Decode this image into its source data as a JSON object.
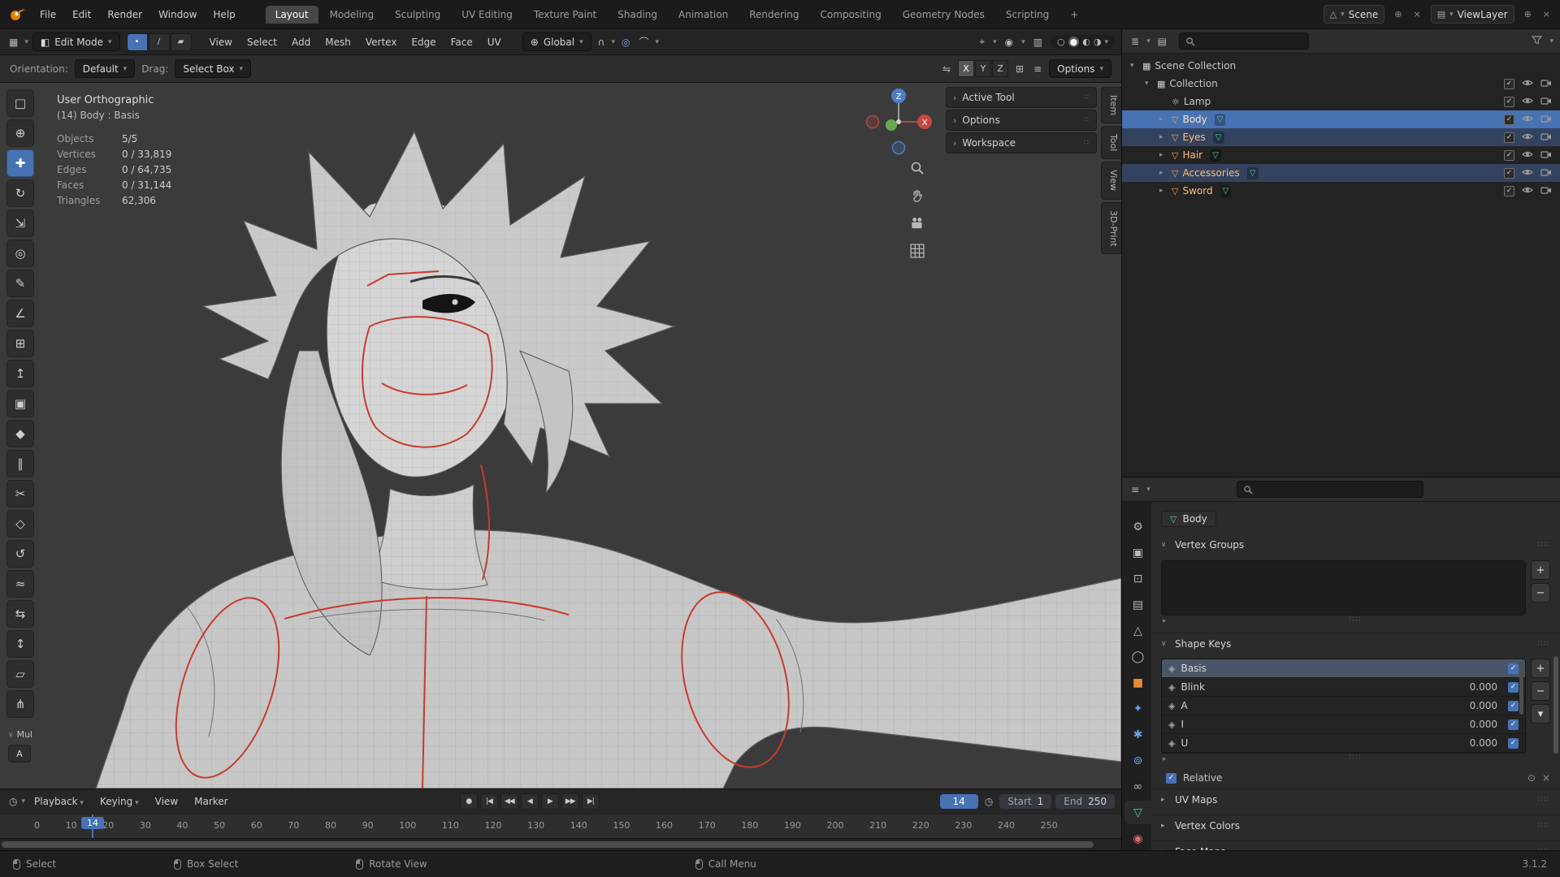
{
  "colors": {
    "accent": "#4772b3",
    "object_orange": "#ffa04d",
    "selected_text": "#ffbd7a",
    "mesh_green": "#3fd6a4",
    "seam_red": "#c93a2f"
  },
  "icons": {
    "tri_down": "▾",
    "tri_right": "▸",
    "chevron_down": "∨",
    "chevron_right": "›",
    "plus": "+",
    "minus": "−",
    "grip": "∷∷",
    "dots_grip": "∷",
    "check": "✓",
    "close": "×",
    "new": "⊕",
    "mesh": "▽",
    "collection": "▦",
    "shapekey": "◈",
    "magnet": "∩",
    "proportional": "◎",
    "falloff": "⌒",
    "pin": "⊙",
    "editor_viewport": "▦",
    "editor_outliner": "≣",
    "editor_properties": "≡",
    "editor_timeline": "◷",
    "objects_filter": "▤",
    "mirror": "⇋",
    "grid": "⊞",
    "sliders": "≡",
    "xray": "▥",
    "overlays": "◉",
    "gizmos": "⌖",
    "scene": "△",
    "view_layer": "▤",
    "vertex_mode": "•",
    "edge_mode": "∕",
    "face_mode": "▰",
    "edit_mode": "◧",
    "global_orientation": "⊕",
    "shading_wireframe": "○",
    "shading_solid": "●",
    "shading_material": "◐",
    "shading_rendered": "◑"
  },
  "topbar": {
    "menus": [
      "File",
      "Edit",
      "Render",
      "Window",
      "Help"
    ],
    "workspaces": [
      {
        "id": "workspace-tab-layout",
        "label": "Layout",
        "active": true
      },
      {
        "id": "workspace-tab-modeling",
        "label": "Modeling"
      },
      {
        "id": "workspace-tab-sculpting",
        "label": "Sculpting"
      },
      {
        "id": "workspace-tab-uv-editing",
        "label": "UV Editing"
      },
      {
        "id": "workspace-tab-texture-paint",
        "label": "Texture Paint"
      },
      {
        "id": "workspace-tab-shading",
        "label": "Shading"
      },
      {
        "id": "workspace-tab-animation",
        "label": "Animation"
      },
      {
        "id": "workspace-tab-rendering",
        "label": "Rendering"
      },
      {
        "id": "workspace-tab-compositing",
        "label": "Compositing"
      },
      {
        "id": "workspace-tab-geometry-nodes",
        "label": "Geometry Nodes"
      },
      {
        "id": "workspace-tab-scripting",
        "label": "Scripting"
      },
      {
        "id": "add-workspace-tab",
        "label": "+"
      }
    ],
    "scene_label": "Scene",
    "view_layer_label": "ViewLayer"
  },
  "viewport_header": {
    "mode_label": "Edit Mode",
    "menus": [
      "View",
      "Select",
      "Add",
      "Mesh",
      "Vertex",
      "Edge",
      "Face",
      "UV"
    ],
    "orientation": "Global"
  },
  "tool_settings": {
    "orientation_label": "Orientation:",
    "orientation_value": "Default",
    "drag_label": "Drag:",
    "drag_value": "Select Box",
    "mirror": [
      {
        "id": "mirror-x-button",
        "label": "X",
        "active": true
      },
      {
        "id": "mirror-y-button",
        "label": "Y"
      },
      {
        "id": "mirror-z-button",
        "label": "Z"
      }
    ],
    "options_label": "Options"
  },
  "toolbox": {
    "tools": [
      {
        "id": "select-box-tool",
        "glyph": "□"
      },
      {
        "id": "cursor-tool",
        "glyph": "⊕"
      },
      {
        "id": "move-tool",
        "glyph": "✚",
        "active": true
      },
      {
        "id": "rotate-tool",
        "glyph": "↻"
      },
      {
        "id": "scale-tool",
        "glyph": "⇲"
      },
      {
        "id": "transform-tool",
        "glyph": "◎"
      },
      {
        "id": "annotate-tool",
        "glyph": "✎"
      },
      {
        "id": "measure-tool",
        "glyph": "∠"
      },
      {
        "id": "add-cube-tool",
        "glyph": "⊞"
      },
      {
        "id": "extrude-region-tool",
        "glyph": "↥"
      },
      {
        "id": "inset-faces-tool",
        "glyph": "▣"
      },
      {
        "id": "bevel-tool",
        "glyph": "◆"
      },
      {
        "id": "loop-cut-tool",
        "glyph": "∥"
      },
      {
        "id": "knife-tool",
        "glyph": "✂"
      },
      {
        "id": "poly-build-tool",
        "glyph": "◇"
      },
      {
        "id": "spin-tool",
        "glyph": "↺"
      },
      {
        "id": "smooth-tool",
        "glyph": "≈"
      },
      {
        "id": "edge-slide-tool",
        "glyph": "⇆"
      },
      {
        "id": "shrink-fatten-tool",
        "glyph": "↕"
      },
      {
        "id": "shear-tool",
        "glyph": "▱"
      },
      {
        "id": "rip-region-tool",
        "glyph": "⋔"
      }
    ],
    "footer_label": "Mul",
    "footer_button": "A"
  },
  "viewport": {
    "view_mode": "User Orthographic",
    "object_info": "(14) Body : Basis",
    "stats": [
      {
        "label": "Objects",
        "value": "5/5"
      },
      {
        "label": "Vertices",
        "value": "0 / 33,819"
      },
      {
        "label": "Edges",
        "value": "0 / 64,735"
      },
      {
        "label": "Faces",
        "value": "0 / 31,144"
      },
      {
        "label": "Triangles",
        "value": "62,306"
      }
    ],
    "gizmo": {
      "z": "Z",
      "x": "X"
    },
    "sidebar_panels": [
      {
        "id": "panel-active-tool",
        "label": "Active Tool"
      },
      {
        "id": "panel-options",
        "label": "Options"
      },
      {
        "id": "panel-workspace",
        "label": "Workspace"
      }
    ],
    "sidebar_tabs": [
      {
        "id": "sidebar-tab-item",
        "label": "Item"
      },
      {
        "id": "sidebar-tab-tool",
        "label": "Tool"
      },
      {
        "id": "sidebar-tab-view",
        "label": "View"
      },
      {
        "id": "sidebar-tab-3d-print",
        "label": "3D-Print"
      }
    ]
  },
  "outliner": {
    "scene_collection": "Scene Collection",
    "collection": "Collection",
    "items": [
      {
        "id": "outliner-item-lamp",
        "name": "Lamp",
        "kind": "lamp",
        "glyph": "☼"
      },
      {
        "id": "outliner-item-body",
        "name": "Body",
        "kind": "mesh",
        "glyph": "▽",
        "state": "active"
      },
      {
        "id": "outliner-item-eyes",
        "name": "Eyes",
        "kind": "mesh",
        "glyph": "▽",
        "state": "selected"
      },
      {
        "id": "outliner-item-hair",
        "name": "Hair",
        "kind": "mesh",
        "glyph": "▽"
      },
      {
        "id": "outliner-item-accessories",
        "name": "Accessories",
        "kind": "mesh",
        "glyph": "▽",
        "state": "selected"
      },
      {
        "id": "outliner-item-sword",
        "name": "Sword",
        "kind": "mesh",
        "glyph": "▽"
      }
    ]
  },
  "properties": {
    "breadcrumb": {
      "object": "Body"
    },
    "tabs": [
      {
        "id": "tab-tool",
        "glyph": "⚙",
        "color": "#b8b8b8"
      },
      {
        "id": "tab-render",
        "glyph": "▣",
        "color": "#b8b8b8"
      },
      {
        "id": "tab-output",
        "glyph": "⊡",
        "color": "#b8b8b8"
      },
      {
        "id": "tab-view-layer",
        "glyph": "▤",
        "color": "#b8b8b8"
      },
      {
        "id": "tab-scene",
        "glyph": "△",
        "color": "#b8b8b8"
      },
      {
        "id": "tab-world",
        "glyph": "◯",
        "color": "#b8b8b8"
      },
      {
        "id": "tab-object",
        "glyph": "■",
        "color": "#e8883a"
      },
      {
        "id": "tab-modifiers",
        "glyph": "✦",
        "color": "#6ba1e0"
      },
      {
        "id": "tab-particles",
        "glyph": "✱",
        "color": "#6ba1e0"
      },
      {
        "id": "tab-physics",
        "glyph": "⊚",
        "color": "#6ba1e0"
      },
      {
        "id": "tab-constraints",
        "glyph": "∞",
        "color": "#b8b8b8"
      },
      {
        "id": "tab-object-data",
        "glyph": "▽",
        "color": "#3fd6a4",
        "active": true
      },
      {
        "id": "tab-material",
        "glyph": "◉",
        "color": "#e0657a"
      }
    ],
    "vertex_groups_title": "Vertex Groups",
    "shape_keys_title": "Shape Keys",
    "shape_keys": [
      {
        "name": "Basis",
        "value": "",
        "active": true
      },
      {
        "name": "Blink",
        "value": "0.000"
      },
      {
        "name": "A",
        "value": "0.000"
      },
      {
        "name": "I",
        "value": "0.000"
      },
      {
        "name": "U",
        "value": "0.000"
      }
    ],
    "relative_label": "Relative",
    "collapsed_sections": [
      {
        "id": "panel-uv-maps",
        "label": "UV Maps"
      },
      {
        "id": "panel-vertex-colors",
        "label": "Vertex Colors"
      },
      {
        "id": "panel-face-maps",
        "label": "Face Maps"
      }
    ]
  },
  "timeline": {
    "menus": [
      {
        "label": "Playback",
        "state": "has-chevron"
      },
      {
        "label": "Keying",
        "state": "has-chevron"
      },
      {
        "label": "View"
      },
      {
        "label": "Marker"
      }
    ],
    "transport": [
      {
        "id": "record-button",
        "glyph": "●"
      },
      {
        "id": "jump-start-button",
        "glyph": "|◀"
      },
      {
        "id": "prev-keyframe-button",
        "glyph": "◀◀"
      },
      {
        "id": "play-reverse-button",
        "glyph": "◀"
      },
      {
        "id": "play-button",
        "glyph": "▶"
      },
      {
        "id": "next-keyframe-button",
        "glyph": "▶▶"
      },
      {
        "id": "jump-end-button",
        "glyph": "▶|"
      }
    ],
    "current_frame": "14",
    "start_label": "Start",
    "start_value": "1",
    "end_label": "End",
    "end_value": "250",
    "ticks": [
      "0",
      "10",
      "20",
      "30",
      "40",
      "50",
      "60",
      "70",
      "80",
      "90",
      "100",
      "110",
      "120",
      "130",
      "140",
      "150",
      "160",
      "170",
      "180",
      "190",
      "200",
      "210",
      "220",
      "230",
      "240",
      "250"
    ]
  },
  "statusbar": {
    "hints": [
      {
        "label": "Select"
      },
      {
        "label": "Box Select"
      },
      {
        "label": "Rotate View"
      },
      {
        "label": "Call Menu"
      }
    ],
    "version": "3.1.2"
  }
}
